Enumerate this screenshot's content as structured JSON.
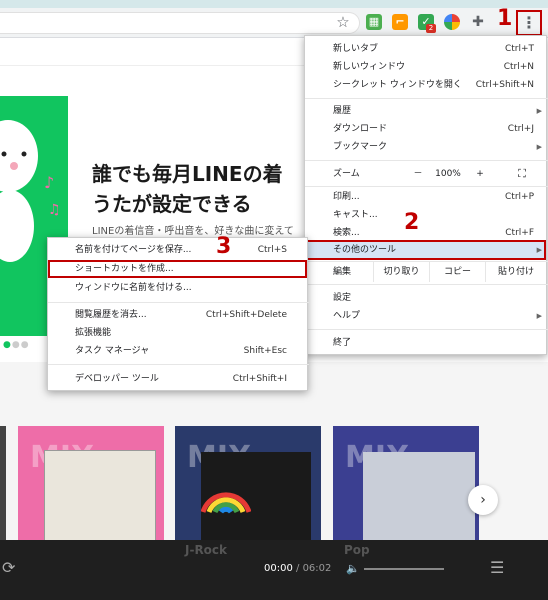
{
  "browser": {
    "star_icon": "star-icon",
    "menu_icon": "vertical-dots-icon",
    "ext_badge": "2",
    "step_labels": [
      "1",
      "2",
      "3"
    ]
  },
  "page": {
    "banner_line1": "誰でも毎月LINEの着",
    "banner_line2": "うたが設定できる",
    "banner_sub": "LINEの着信音・呼出音を、好きな曲に変えて",
    "card_label": "MIX",
    "card_titles": [
      "J-Rock",
      "Pop"
    ],
    "player": {
      "time_current": "00:00",
      "time_total": "/ 06:02"
    }
  },
  "menu": {
    "items_top": [
      {
        "label": "新しいタブ",
        "shortcut": "Ctrl+T"
      },
      {
        "label": "新しいウィンドウ",
        "shortcut": "Ctrl+N"
      },
      {
        "label": "シークレット ウィンドウを開く",
        "shortcut": "Ctrl+Shift+N"
      }
    ],
    "items_mid": [
      {
        "label": "履歴"
      },
      {
        "label": "ダウンロード",
        "shortcut": "Ctrl+J"
      },
      {
        "label": "ブックマーク"
      }
    ],
    "zoom": {
      "label": "ズーム",
      "minus": "－",
      "value": "100%",
      "plus": "+"
    },
    "items_after_zoom": [
      {
        "label": "印刷...",
        "shortcut": "Ctrl+P"
      },
      {
        "label": "キャスト...",
        "shortcut": ""
      },
      {
        "label": "検索...",
        "shortcut": "Ctrl+F"
      },
      {
        "label": "その他のツール"
      }
    ],
    "edit": {
      "label": "編集",
      "cut": "切り取り",
      "copy": "コピー",
      "paste": "貼り付け"
    },
    "settings": "設定",
    "help": "ヘルプ",
    "exit": "終了"
  },
  "submenu": {
    "items": [
      {
        "label": "名前を付けてページを保存...",
        "shortcut": "Ctrl+S"
      },
      {
        "label": "ショートカットを作成...",
        "shortcut": ""
      },
      {
        "label": "ウィンドウに名前を付ける...",
        "shortcut": ""
      },
      {
        "label": "閲覧履歴を消去...",
        "shortcut": "Ctrl+Shift+Delete"
      },
      {
        "label": "拡張機能",
        "shortcut": ""
      },
      {
        "label": "タスク マネージャ",
        "shortcut": "Shift+Esc"
      },
      {
        "label": "デベロッパー ツール",
        "shortcut": "Ctrl+Shift+I"
      }
    ]
  },
  "colors": {
    "accent_red": "#c00000",
    "line_green": "#11c55f",
    "highlight": "#d6e4f5"
  }
}
